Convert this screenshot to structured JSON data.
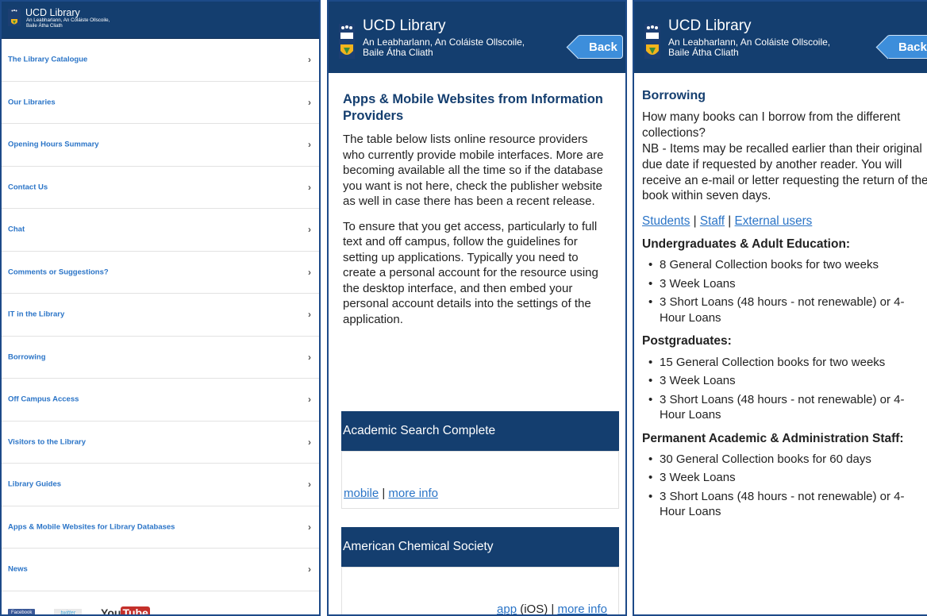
{
  "brand": {
    "title": "UCD Library",
    "subtitle_line1": "An Leabharlann, An Coláiste Ollscoile,",
    "subtitle_line2": "Baile Átha Cliath",
    "crest_text": "UCD",
    "crest_small": "DUBLIN"
  },
  "back_label": "Back",
  "menu": {
    "items": [
      {
        "label": "The Library Catalogue"
      },
      {
        "label": "Our Libraries"
      },
      {
        "label": "Opening Hours Summary"
      },
      {
        "label": "Contact Us"
      },
      {
        "label": "Chat"
      },
      {
        "label": "Comments or Suggestions?"
      },
      {
        "label": "IT in the Library"
      },
      {
        "label": "Borrowing"
      },
      {
        "label": "Off Campus Access"
      },
      {
        "label": "Visitors to the Library"
      },
      {
        "label": "Library Guides"
      },
      {
        "label": "Apps & Mobile Websites for Library Databases"
      },
      {
        "label": "News"
      }
    ],
    "chevron": "›"
  },
  "social": {
    "facebook": "Facebook",
    "twitter": "twitter",
    "youtube_a": "You",
    "youtube_b": "Tube"
  },
  "apps_page": {
    "heading": "Apps & Mobile Websites from Information Providers",
    "para1": "The table below lists online resource providers who currently provide mobile interfaces. More are becoming available all the time so if the database you want is not here, check the publisher website as well in case there has been a recent release.",
    "para2": "To ensure that you get access, particularly to full text and off campus, follow the guidelines for setting up applications. Typically you need to create a personal account for the resource using the desktop interface, and then embed your personal account details into the settings of the application.",
    "resources": [
      {
        "name": "Academic Search Complete",
        "link1": "mobile",
        "sep": " | ",
        "link2": "more info"
      },
      {
        "name": "American Chemical Society",
        "link1": "app",
        "mid": " (iOS) | ",
        "link2": "more info"
      }
    ]
  },
  "borrowing_page": {
    "heading": "Borrowing",
    "question": "How many books can I borrow from the different collections?",
    "note": "NB - Items may be recalled earlier than their original due date if requested by another reader. You will receive an e-mail or letter requesting the return of the book within seven days.",
    "audience_links": [
      "Students",
      "Staff",
      "External users"
    ],
    "sep": " | ",
    "sections": [
      {
        "title": "Undergraduates & Adult Education:",
        "items": [
          "8 General Collection books for two weeks",
          "3 Week Loans",
          "3 Short Loans (48 hours - not renewable) or 4-Hour Loans"
        ]
      },
      {
        "title": "Postgraduates:",
        "items": [
          "15 General Collection books for two weeks",
          "3 Week Loans",
          "3 Short Loans (48 hours - not renewable) or 4-Hour Loans"
        ]
      },
      {
        "title": "Permanent Academic & Administration Staff:",
        "items": [
          "30 General Collection books for 60 days",
          "3 Week Loans",
          "3 Short Loans (48 hours - not renewable) or 4-Hour Loans"
        ]
      }
    ]
  },
  "colors": {
    "header": "#143e6f",
    "link": "#2a74c7",
    "back": "#3d8edb"
  }
}
